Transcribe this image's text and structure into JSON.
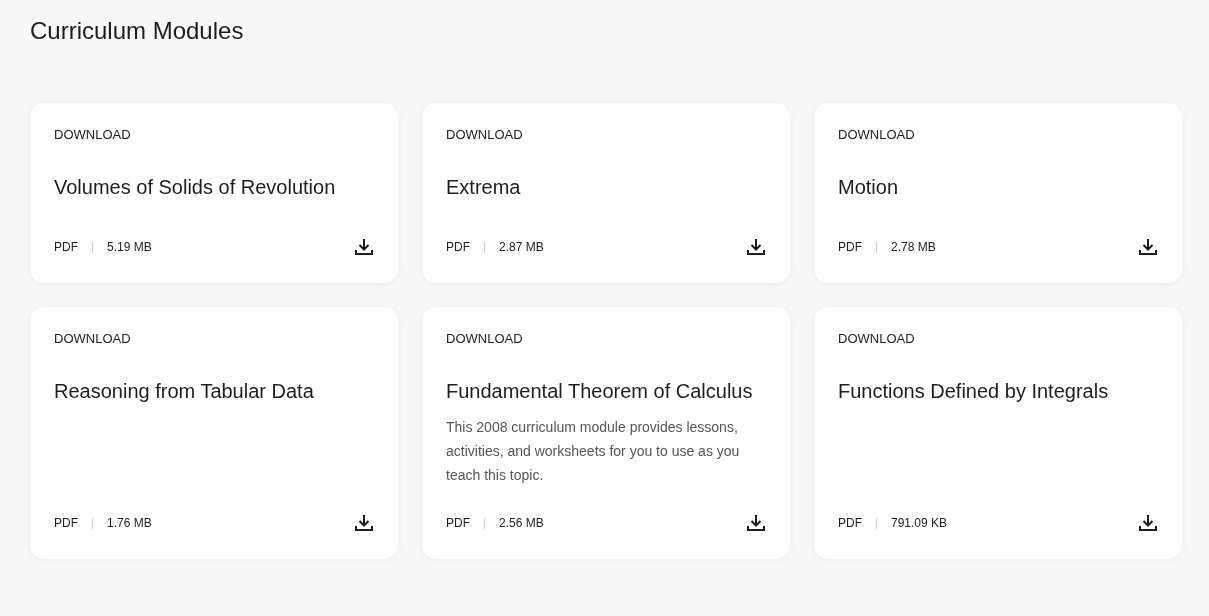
{
  "heading": "Curriculum Modules",
  "modules": [
    {
      "label": "DOWNLOAD",
      "title": "Volumes of Solids of Revolution",
      "format": "PDF",
      "size": "5.19 MB"
    },
    {
      "label": "DOWNLOAD",
      "title": "Extrema",
      "format": "PDF",
      "size": "2.87 MB"
    },
    {
      "label": "DOWNLOAD",
      "title": "Motion",
      "format": "PDF",
      "size": "2.78 MB"
    },
    {
      "label": "DOWNLOAD",
      "title": "Reasoning from Tabular Data",
      "format": "PDF",
      "size": "1.76 MB"
    },
    {
      "label": "DOWNLOAD",
      "title": "Fundamental Theorem of Calculus",
      "description": "This 2008 curriculum module provides lessons, activities, and worksheets for you to use as you teach this topic.",
      "format": "PDF",
      "size": "2.56 MB"
    },
    {
      "label": "DOWNLOAD",
      "title": "Functions Defined by Integrals",
      "format": "PDF",
      "size": "791.09 KB"
    }
  ]
}
